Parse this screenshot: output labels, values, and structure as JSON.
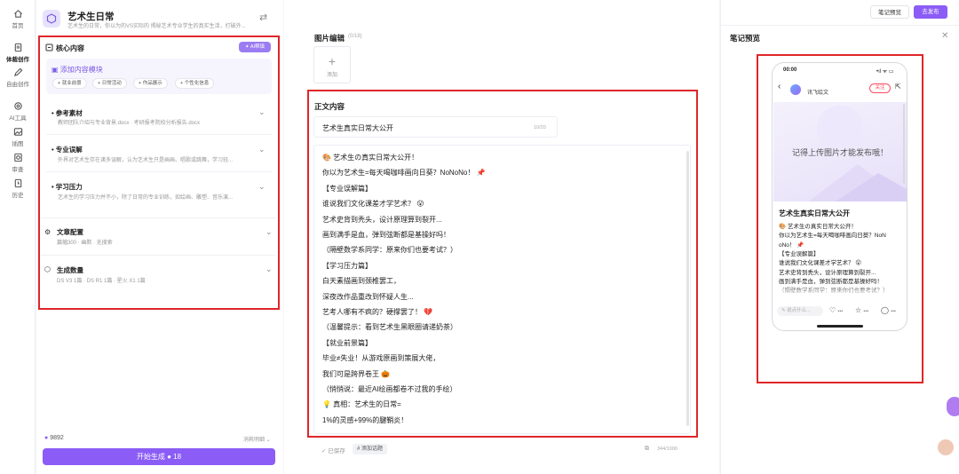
{
  "rail": {
    "items": [
      {
        "label": "首页",
        "icon": "home-icon"
      },
      {
        "label": "体裁创作",
        "icon": "document-icon"
      },
      {
        "label": "自由创作",
        "icon": "pen-icon"
      },
      {
        "label": "AI工具",
        "icon": "ai-tool-icon"
      },
      {
        "label": "插图",
        "icon": "image-icon"
      },
      {
        "label": "审查",
        "icon": "review-icon"
      },
      {
        "label": "历史",
        "icon": "history-icon"
      }
    ]
  },
  "app": {
    "title": "艺术生日常",
    "subtitle": "艺术生的日常，你以为的VS实际的 揭秘艺术专业学生的真实生活，打破外..."
  },
  "core": {
    "title": "核心内容",
    "ai_button": "AI帮填",
    "module_title": "添加内容模块",
    "chips": [
      "+ 就业前景",
      "+ 日常活动",
      "+ 作品展示",
      "+ 个性化信息"
    ]
  },
  "sections": [
    {
      "title": "参考素材",
      "desc": "教师团队介绍与专业背景.docx · 考研报考院校分析报告.docx"
    },
    {
      "title": "专业误解",
      "desc": "外界对艺术生存在诸多误解，认为艺术生只是画画、唱歌或跳舞，学习轻..."
    },
    {
      "title": "学习压力",
      "desc": "艺术生的学习压力并不小，除了日常的专业训练，如绘画、雕塑、音乐演..."
    }
  ],
  "config": {
    "title": "文章配置",
    "desc": "篇幅300 · 幽默 · 无搜索"
  },
  "gen_count": {
    "title": "生成数量",
    "desc": "DS V3 1篇 · DS R1 1篇 · 星火 X1 1篇"
  },
  "footer": {
    "credits": "9892",
    "consume": "消耗明细",
    "generate": "开始生成 ● 18"
  },
  "center": {
    "image_title": "图片编辑",
    "image_count": "(0/18)",
    "add_label": "添加",
    "body_title": "正文内容",
    "title_value": "艺术生真实日常大公开",
    "title_count": "10/20",
    "body_lines": [
      "🎨 艺术生の真实日常大公开！",
      "你以为艺术生=每天喝咖啡画向日葵？NoNoNo！ 📌",
      "【专业误解篇】",
      "谁说我们文化课差才学艺术？ 😮",
      "艺术史背到秃头，设计原理算到裂开...",
      "画到满手是血，弹到弦断都是基操好吗！",
      "（隔壁数学系同学：原来你们也要考试？）",
      "【学习压力篇】",
      "白天素描画到颈椎罢工，",
      "深夜改作品重改到怀疑人生...",
      "艺考人哪有不疯的？硬撑罢了！ 💔",
      "（温馨提示：看到艺术生黑眼圈请递奶茶）",
      "【就业前景篇】",
      "毕业≠失业！从游戏原画到策展大佬，",
      "我们可是跨界卷王 🎃",
      "（悄悄说：最近AI绘画都卷不过我的手绘）",
      "💡 真相：艺术生的日常=",
      "1%的灵感+99%的腱鞘炎！"
    ],
    "saved": "✓ 已保存",
    "add_topic": "# 添加话题",
    "body_count": "344/1000"
  },
  "right": {
    "preview_btn": "笔记预览",
    "publish_btn": "去发布",
    "title": "笔记预览",
    "phone": {
      "time": "00:00",
      "status": "•ıl ᯤ ▭",
      "user": "讯飞绘文",
      "follow": "关注",
      "hint": "记得上传图片才能发布哦！",
      "note_title": "艺术生真实日常大公开",
      "lines": [
        "🎨 艺术生の真实日常大公开！",
        "你以为艺术生=每天喝咖啡画向日葵？NoN",
        "oNo！ 📌",
        "【专业误解篇】",
        "谁说我们文化课差才学艺术？ 😮",
        "艺术史背到秃头，设计原理算到裂开...",
        "画到满手是血，弹到弦断都是基操好吗！",
        "（隔壁数学系同学：原来你们也要考试？）"
      ],
      "input_placeholder": "说点什么...",
      "like": "•••",
      "fav": "•••",
      "comment": "•••"
    }
  }
}
